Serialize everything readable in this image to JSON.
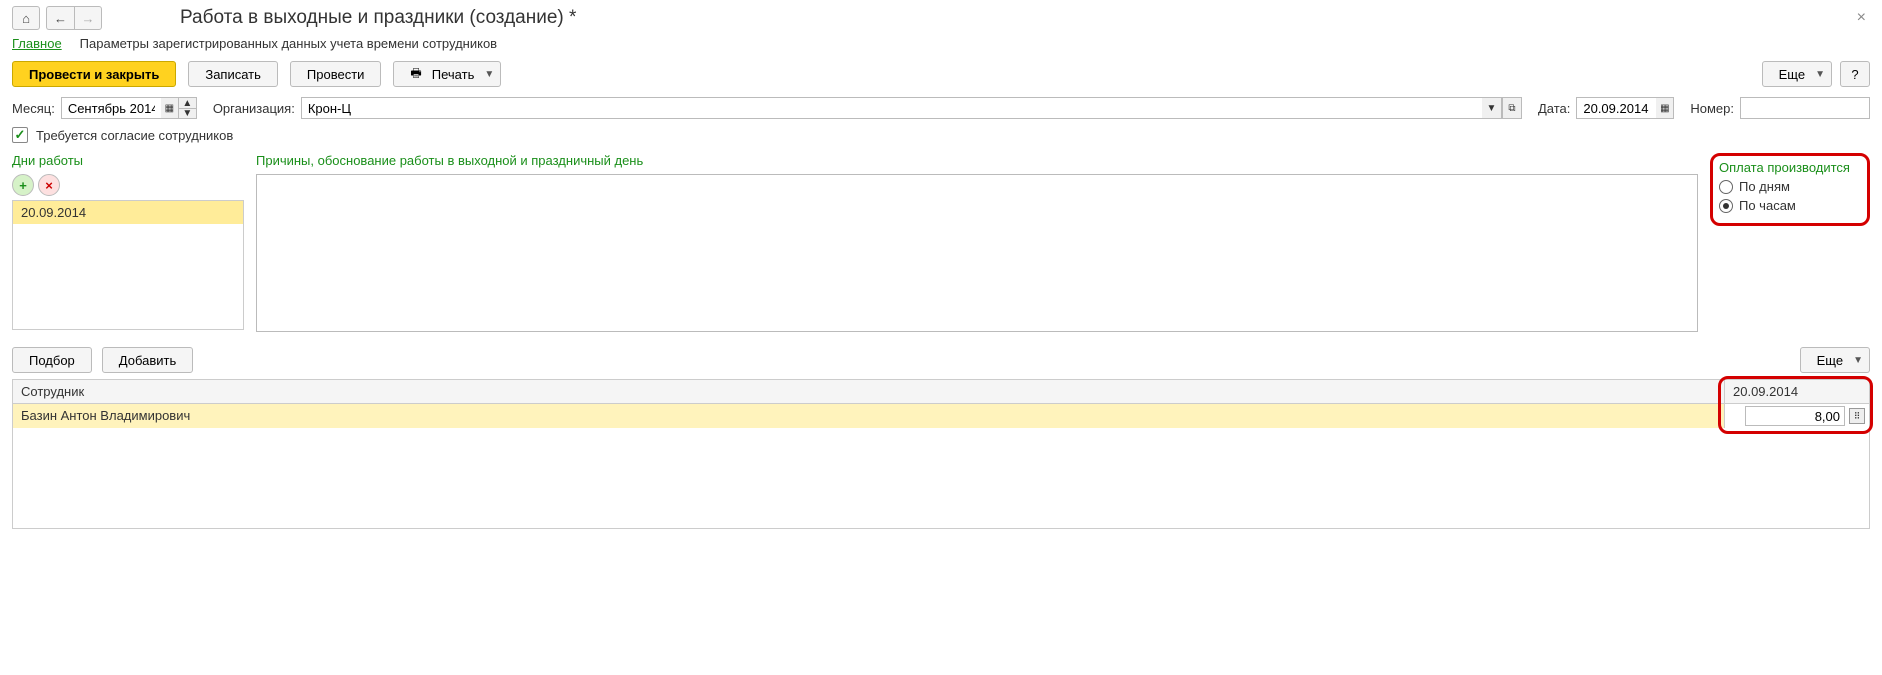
{
  "nav": {
    "home": "⌂",
    "back": "←",
    "forward": "→"
  },
  "title": "Работа в выходные и праздники (создание) *",
  "close": "×",
  "tabs": {
    "main": "Главное",
    "params": "Параметры зарегистрированных данных учета времени сотрудников"
  },
  "toolbar": {
    "post_close": "Провести и закрыть",
    "save": "Записать",
    "post": "Провести",
    "print": "Печать",
    "more": "Еще",
    "help": "?"
  },
  "fields": {
    "month_label": "Месяц:",
    "month_value": "Сентябрь 2014",
    "org_label": "Организация:",
    "org_value": "Крон-Ц",
    "date_label": "Дата:",
    "date_value": "20.09.2014",
    "number_label": "Номер:",
    "number_value": ""
  },
  "consent": {
    "checked": true,
    "label": "Требуется согласие сотрудников"
  },
  "days": {
    "label": "Дни работы",
    "items": [
      "20.09.2014"
    ]
  },
  "reason": {
    "label": "Причины, обоснование работы в выходной и праздничный день",
    "value": ""
  },
  "payment": {
    "label": "Оплата производится",
    "by_days": "По дням",
    "by_hours": "По часам",
    "selected": "by_hours"
  },
  "bottom": {
    "select": "Подбор",
    "add": "Добавить",
    "more": "Еще"
  },
  "table": {
    "header_employee": "Сотрудник",
    "header_date": "20.09.2014",
    "rows": [
      {
        "employee": "Базин Антон Владимирович",
        "hours": "8,00"
      }
    ]
  },
  "icons": {
    "caret": "▼",
    "up": "▲",
    "dn": "▼",
    "cal": "▦",
    "open": "⧉",
    "dots": "⠿"
  }
}
